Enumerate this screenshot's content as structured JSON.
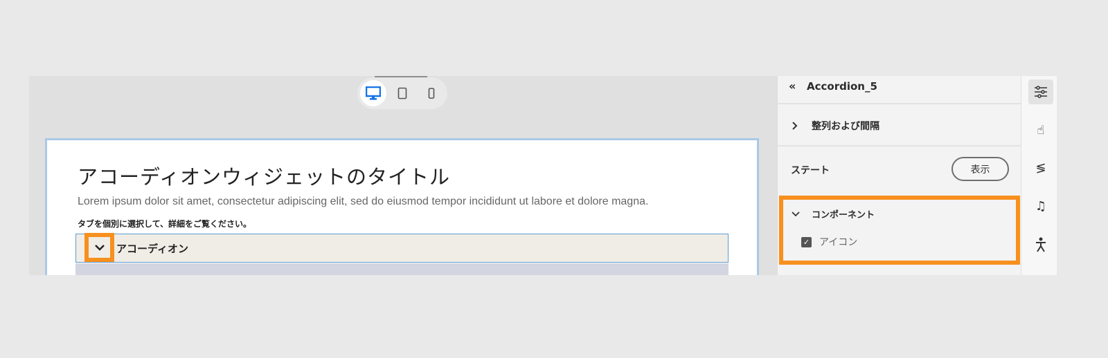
{
  "canvas": {
    "devices": [
      {
        "name": "desktop",
        "selected": true
      },
      {
        "name": "tablet",
        "selected": false
      },
      {
        "name": "mobile",
        "selected": false
      }
    ],
    "title": "アコーディオンウィジェットのタイトル",
    "description": "Lorem ipsum dolor sit amet, consectetur adipiscing elit, sed do eiusmod tempor incididunt ut labore et dolore magna.",
    "hint": "タブを個別に選択して、詳細をご覧ください。",
    "accordion_label": "アコーディオン"
  },
  "panel": {
    "back_icon": "«",
    "component_name": "Accordion_5",
    "section_alignment": "整列および間隔",
    "state_label": "ステート",
    "state_button": "表示",
    "components_section": "コンポーネント",
    "icon_checkbox_label": "アイコン",
    "icon_checkbox_checked": true
  },
  "rail": [
    "sliders-icon",
    "touch-icon",
    "motion-icon",
    "music-icon",
    "accessibility-icon"
  ],
  "colors": {
    "highlight": "#f7901e",
    "accent": "#1473e6",
    "card_border": "#a9c9e6"
  }
}
